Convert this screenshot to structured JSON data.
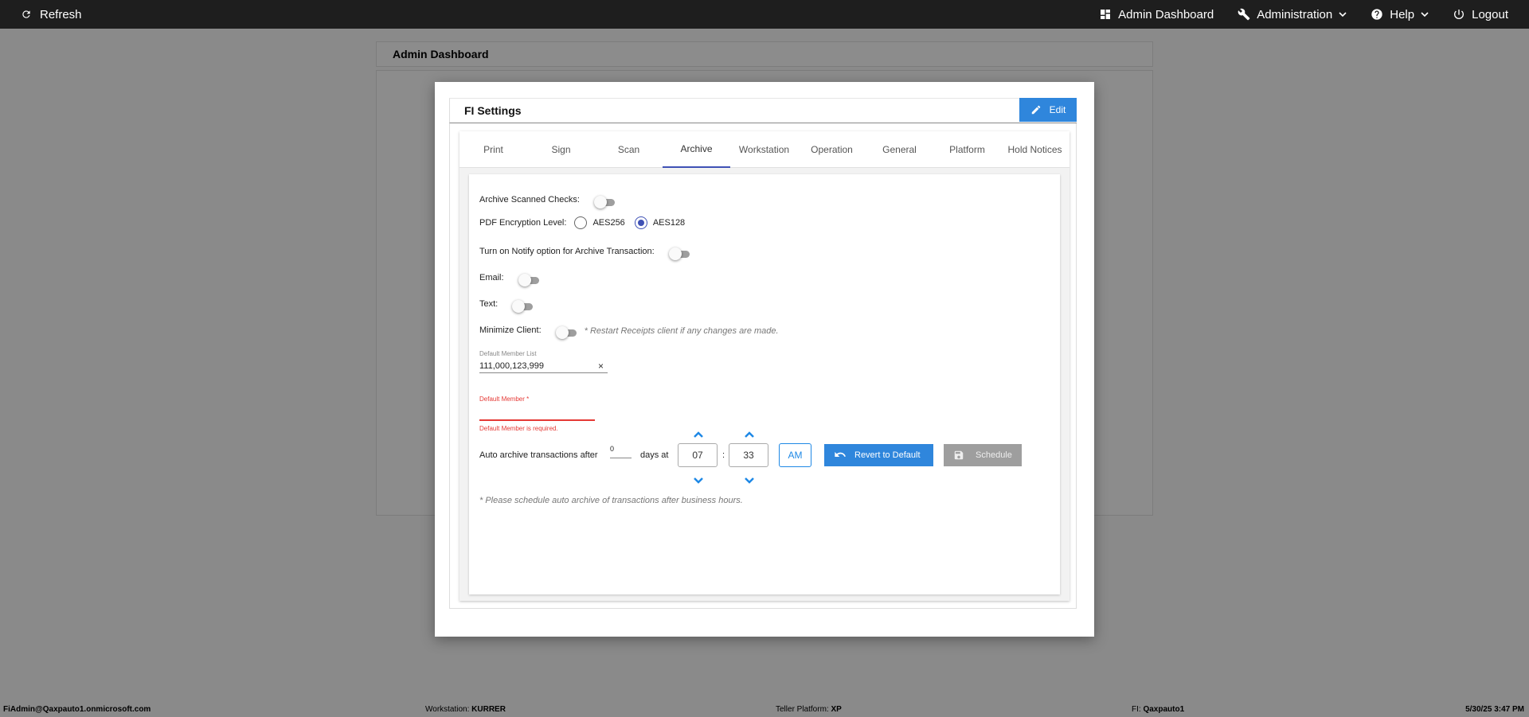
{
  "topbar": {
    "refresh": "Refresh",
    "admin_dashboard": "Admin Dashboard",
    "administration": "Administration",
    "help": "Help",
    "logout": "Logout"
  },
  "background": {
    "header": "Admin Dashboard"
  },
  "modal": {
    "title": "FI Settings",
    "edit": "Edit",
    "tabs": [
      "Print",
      "Sign",
      "Scan",
      "Archive",
      "Workstation",
      "Operation",
      "General",
      "Platform",
      "Hold Notices"
    ],
    "active_tab": "Archive",
    "archive": {
      "archive_scanned_checks": "Archive Scanned Checks:",
      "pdf_encryption_level": "PDF Encryption Level:",
      "aes256": "AES256",
      "aes128": "AES128",
      "selected_encryption": "AES128",
      "notify_option": "Turn on Notify option for Archive Transaction:",
      "email": "Email:",
      "text": "Text:",
      "minimize_client": "Minimize Client:",
      "restart_note": "* Restart Receipts client if any changes are made.",
      "default_member_list_label": "Default Member List",
      "default_member_list_value": "111,000,123,999",
      "clear": "×",
      "default_member_label": "Default Member *",
      "default_member_value": "",
      "default_member_error": "Default Member is required.",
      "auto_archive_prefix": "Auto archive transactions after",
      "days_value": "0",
      "days_at": "days at",
      "hour": "07",
      "colon": ":",
      "minute": "33",
      "ampm": "AM",
      "revert_button": "Revert to Default",
      "schedule_button": "Schedule",
      "schedule_note": "* Please schedule auto archive of transactions after business hours."
    }
  },
  "footer": {
    "user": "FiAdmin@Qaxpauto1.onmicrosoft.com",
    "workstation_label": "Workstation:",
    "workstation_value": "KURRER",
    "teller_platform_label": "Teller Platform:",
    "teller_platform_value": "XP",
    "fi_label": "FI:",
    "fi_value": "Qaxpauto1",
    "datetime": "5/30/25 3:47 PM"
  },
  "colors": {
    "accent": "#2f86dc",
    "tab_indicator": "#3f51b5",
    "error": "#e53935",
    "topbar": "#1e1e1e"
  }
}
